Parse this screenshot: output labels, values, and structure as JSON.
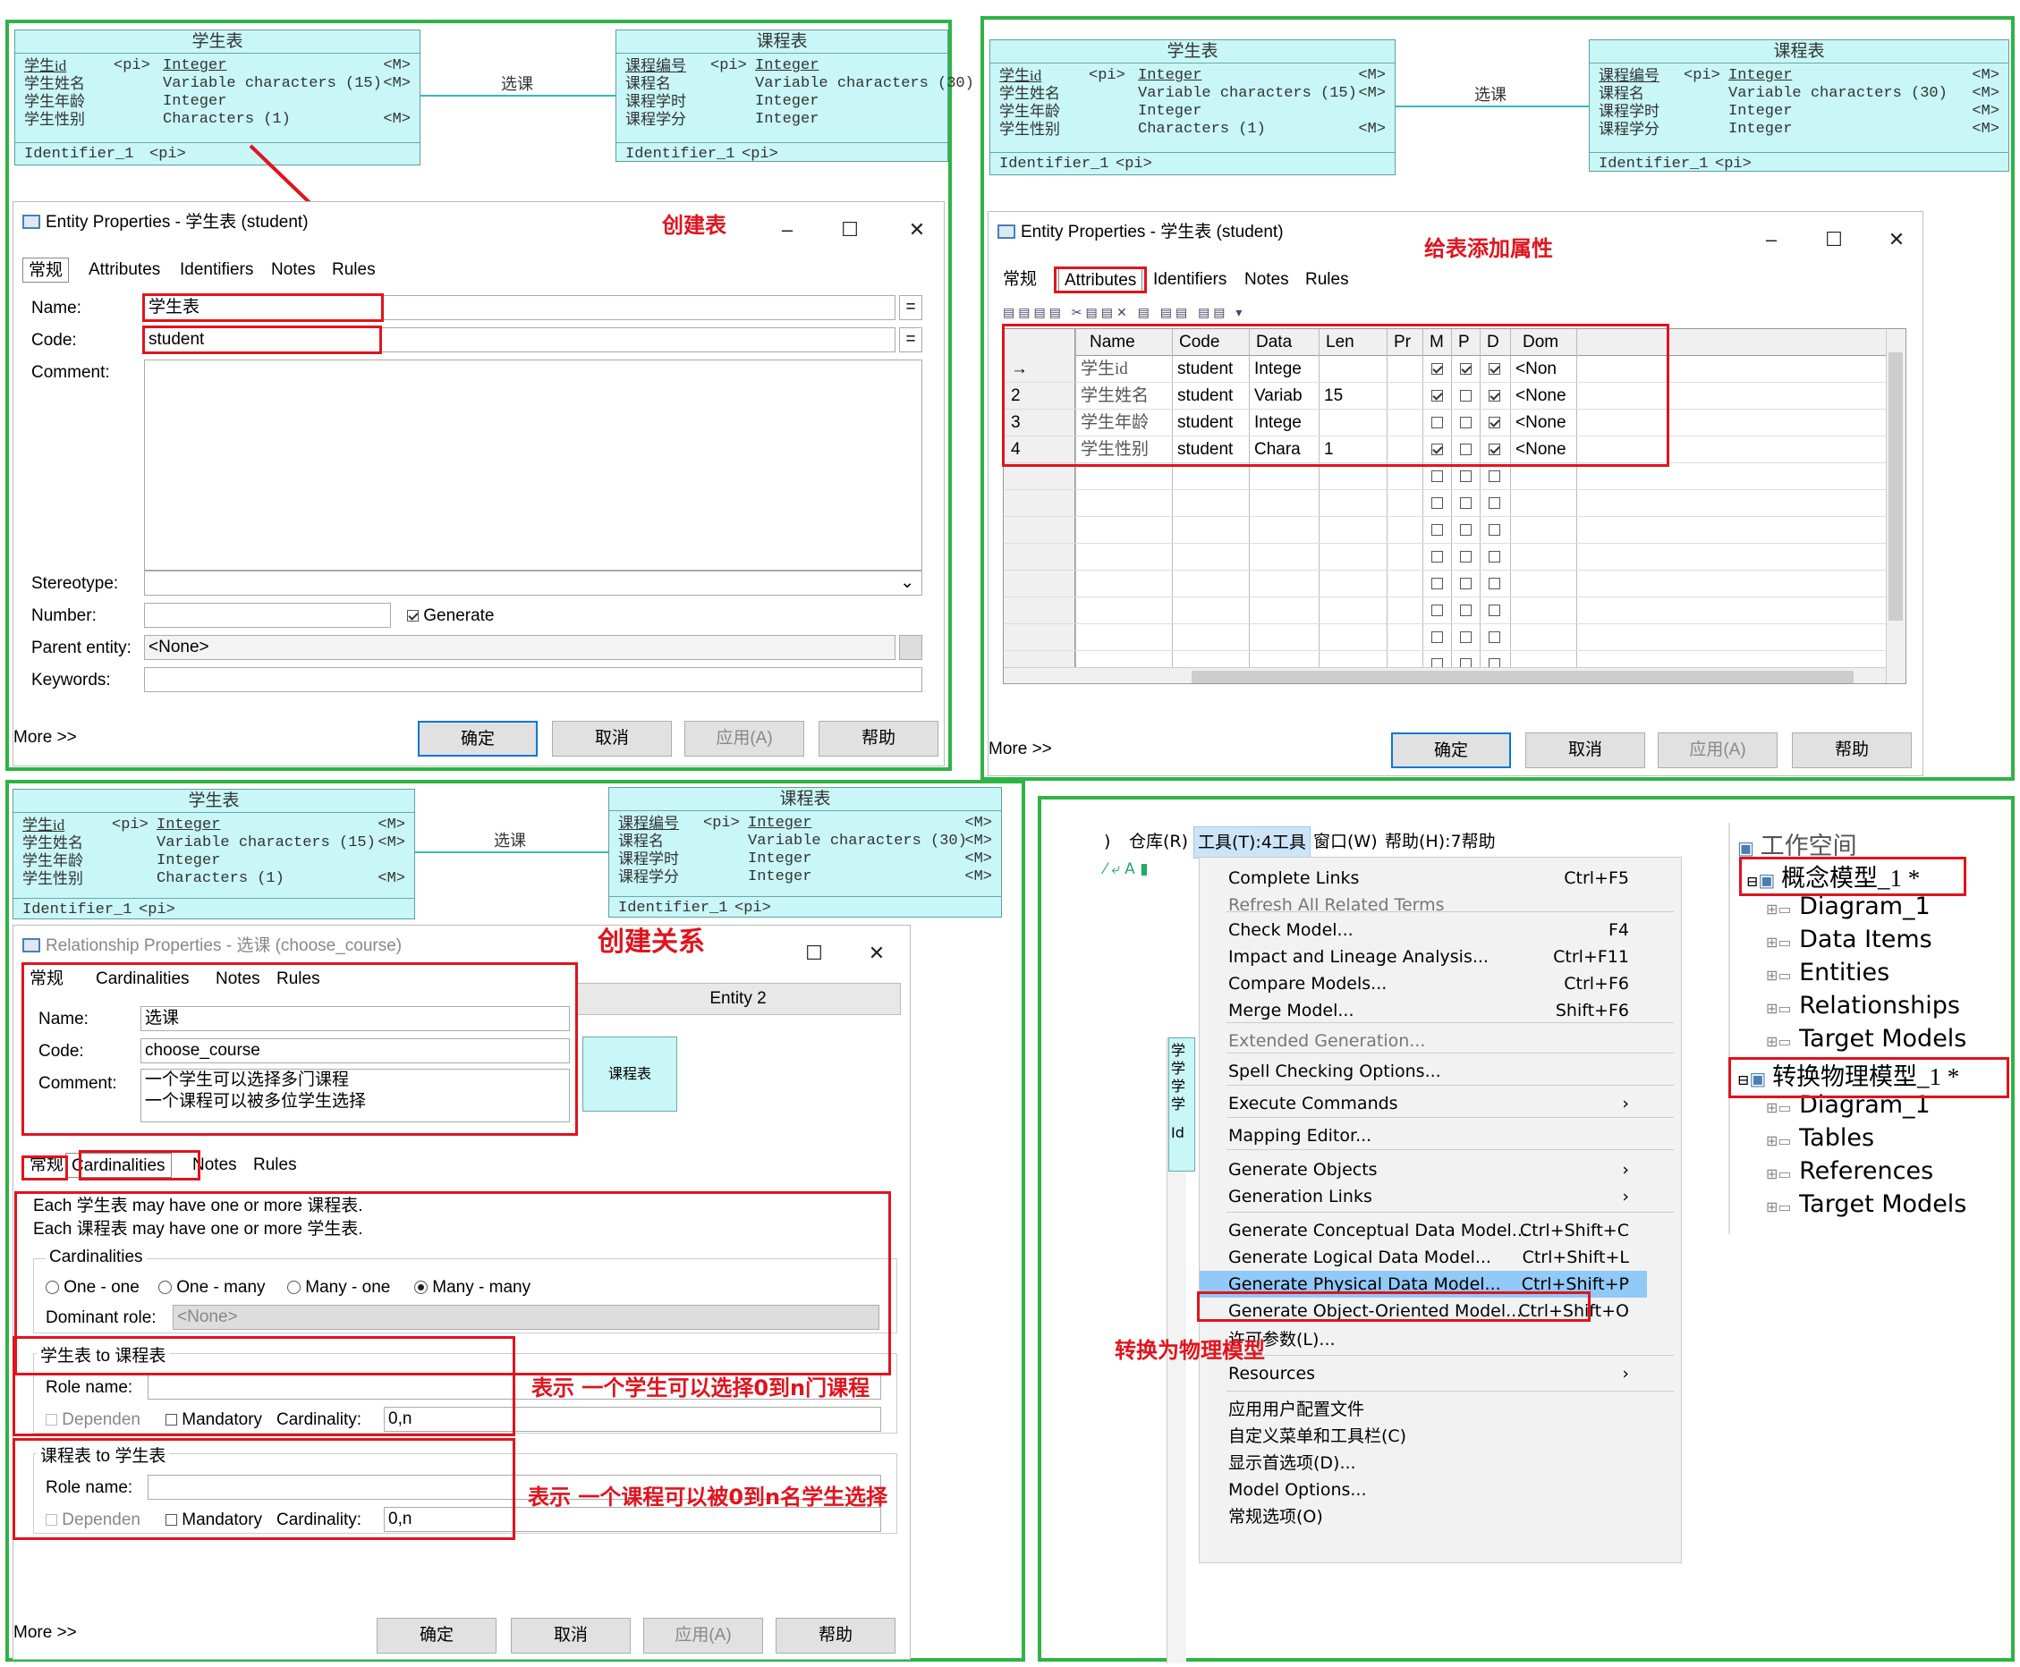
{
  "student_entity": {
    "title": "学生表",
    "rows": [
      {
        "name": "学生id",
        "pi": "<pi>",
        "type": "Integer",
        "m": "<M>"
      },
      {
        "name": "学生姓名",
        "pi": "",
        "type": "Variable characters (15)",
        "m": "<M>"
      },
      {
        "name": "学生年龄",
        "pi": "",
        "type": "Integer",
        "m": ""
      },
      {
        "name": "学生性别",
        "pi": "",
        "type": "Characters (1)",
        "m": "<M>"
      }
    ],
    "identifier": "Identifier_1",
    "identifier_pi": "<pi>"
  },
  "course_entity": {
    "title": "课程表",
    "rows": [
      {
        "name": "课程编号",
        "pi": "<pi>",
        "type": "Integer",
        "m": "<M>"
      },
      {
        "name": "课程名",
        "pi": "",
        "type": "Variable characters (30)",
        "m": "<M>"
      },
      {
        "name": "课程学时",
        "pi": "",
        "type": "Integer",
        "m": "<M>"
      },
      {
        "name": "课程学分",
        "pi": "",
        "type": "Integer",
        "m": "<M>"
      }
    ],
    "identifier": "Identifier_1",
    "identifier_pi": "<pi>"
  },
  "relation_label": "选课",
  "panel1": {
    "annotation": "创建表",
    "dialog_title": "Entity Properties - 学生表 (student)",
    "tabs": [
      "常规",
      "Attributes",
      "Identifiers",
      "Notes",
      "Rules"
    ],
    "name_label": "Name:",
    "name_value": "学生表",
    "code_label": "Code:",
    "code_value": "student",
    "comment_label": "Comment:",
    "stereotype_label": "Stereotype:",
    "number_label": "Number:",
    "generate_label": "Generate",
    "parent_label": "Parent entity:",
    "parent_value": "<None>",
    "keywords_label": "Keywords:",
    "more": "More >>",
    "btn_ok": "确定",
    "btn_cancel": "取消",
    "btn_apply": "应用(A)",
    "btn_help": "帮助"
  },
  "panel2": {
    "annotation": "给表添加属性",
    "dialog_title": "Entity Properties - 学生表 (student)",
    "tabs": [
      "常规",
      "Attributes",
      "Identifiers",
      "Notes",
      "Rules"
    ],
    "columns": [
      "Name",
      "Code",
      "Data",
      "Len",
      "Pr",
      "M",
      "P",
      "D",
      "Dom"
    ],
    "rows": [
      {
        "idx": "→",
        "name": "学生id",
        "code": "student",
        "data": "Intege",
        "len": "",
        "m": true,
        "p": true,
        "d": true,
        "dom": "<Non"
      },
      {
        "idx": "2",
        "name": "学生姓名",
        "code": "student",
        "data": "Variab",
        "len": "15",
        "m": true,
        "p": false,
        "d": true,
        "dom": "<None"
      },
      {
        "idx": "3",
        "name": "学生年龄",
        "code": "student",
        "data": "Intege",
        "len": "",
        "m": false,
        "p": false,
        "d": true,
        "dom": "<None"
      },
      {
        "idx": "4",
        "name": "学生性别",
        "code": "student",
        "data": "Chara",
        "len": "1",
        "m": true,
        "p": false,
        "d": true,
        "dom": "<None"
      }
    ],
    "more": "More >>",
    "btn_ok": "确定",
    "btn_cancel": "取消",
    "btn_apply": "应用(A)",
    "btn_help": "帮助"
  },
  "panel3": {
    "annotation": "创建关系",
    "dialog_title": "Relationship Properties - 选课 (choose_course)",
    "tabs_top": [
      "常规",
      "Cardinalities",
      "Notes",
      "Rules"
    ],
    "entity2_label": "Entity 2",
    "entity2_box": "课程表",
    "name_label": "Name:",
    "name_value": "选课",
    "code_label": "Code:",
    "code_value": "choose_course",
    "comment_label": "Comment:",
    "comment_lines": [
      "一个学生可以选择多门课程",
      "一个课程可以被多位学生选择"
    ],
    "tabs_bottom": [
      "常规",
      "Cardinalities",
      "Notes",
      "Rules"
    ],
    "each1": "Each 学生表 may have one or more 课程表.",
    "each2": "Each 课程表 may have one or more 学生表.",
    "cardinalities_label": "Cardinalities",
    "options": [
      "One - one",
      "One - many",
      "Many - one",
      "Many - many"
    ],
    "selected_option": "Many - many",
    "dominant_label": "Dominant role:",
    "dominant_value": "<None>",
    "group1_title": "学生表 to 课程表",
    "group2_title": "课程表 to 学生表",
    "role_label": "Role name:",
    "dependent_label": "Dependen",
    "mandatory_label": "Mandatory",
    "cardinality_label": "Cardinality:",
    "card1": "0,n",
    "card2": "0,n",
    "note1": "表示 一个学生可以选择0到n门课程",
    "note2": "表示 一个课程可以被0到n名学生选择",
    "more": "More >>",
    "btn_ok": "确定",
    "btn_cancel": "取消",
    "btn_apply": "应用(A)",
    "btn_help": "帮助"
  },
  "panel4": {
    "menubar": [
      "仓库(R)",
      "工具(T):4工具",
      "窗口(W)",
      "帮助(H):7帮助"
    ],
    "menubar_prefix": ")",
    "menu": [
      {
        "label": "Complete Links",
        "shortcut": "Ctrl+F5"
      },
      {
        "label": "Refresh All Related Terms",
        "shortcut": ""
      },
      {
        "label": "Check Model...",
        "shortcut": "F4"
      },
      {
        "label": "Impact and Lineage Analysis...",
        "shortcut": "Ctrl+F11"
      },
      {
        "label": "Compare Models...",
        "shortcut": "Ctrl+F6"
      },
      {
        "label": "Merge Model...",
        "shortcut": "Shift+F6"
      },
      {
        "label": "Extended Generation...",
        "shortcut": ""
      },
      {
        "label": "Spell Checking Options...",
        "shortcut": ""
      },
      {
        "label": "Execute Commands",
        "shortcut": "›"
      },
      {
        "label": "Mapping Editor...",
        "shortcut": ""
      },
      {
        "label": "Generate Objects",
        "shortcut": "›"
      },
      {
        "label": "Generation Links",
        "shortcut": "›"
      },
      {
        "label": "Generate Conceptual Data Model...",
        "shortcut": "Ctrl+Shift+C"
      },
      {
        "label": "Generate Logical Data Model...",
        "shortcut": "Ctrl+Shift+L"
      },
      {
        "label": "Generate Physical Data Model...",
        "shortcut": "Ctrl+Shift+P"
      },
      {
        "label": "Generate Object-Oriented Model...",
        "shortcut": "Ctrl+Shift+O"
      },
      {
        "label": "许可参数(L)...",
        "shortcut": ""
      },
      {
        "label": "Resources",
        "shortcut": "›"
      },
      {
        "label": "应用用户配置文件",
        "shortcut": ""
      },
      {
        "label": "自定义菜单和工具栏(C)",
        "shortcut": ""
      },
      {
        "label": "显示首选项(D)...",
        "shortcut": ""
      },
      {
        "label": "Model Options...",
        "shortcut": ""
      },
      {
        "label": "常规选项(O)",
        "shortcut": ""
      }
    ],
    "annotation": "转换为物理模型",
    "tree": {
      "root": "工作空间",
      "model1": "概念模型_1 *",
      "model1_items": [
        "Diagram_1",
        "Data Items",
        "Entities",
        "Relationships",
        "Target Models"
      ],
      "model2": "转换物理模型_1 *",
      "model2_items": [
        "Diagram_1",
        "Tables",
        "References",
        "Target Models"
      ]
    },
    "side_chars": [
      "学",
      "学",
      "学",
      "学",
      "Id"
    ]
  }
}
